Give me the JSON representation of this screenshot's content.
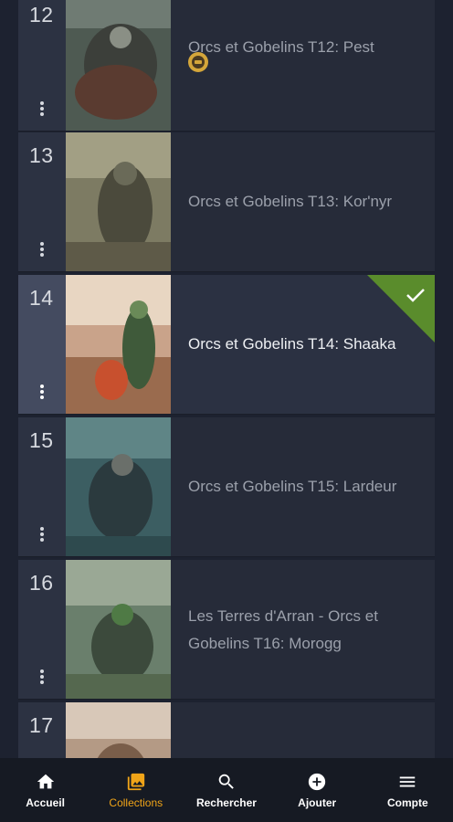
{
  "items": [
    {
      "number": "12",
      "title": "Orcs et Gobelins T12: Pest",
      "state": "reading"
    },
    {
      "number": "13",
      "title": "Orcs et Gobelins T13: Kor'nyr",
      "state": "none"
    },
    {
      "number": "14",
      "title": "Orcs et Gobelins T14: Shaaka",
      "state": "owned"
    },
    {
      "number": "15",
      "title": "Orcs et Gobelins T15: Lardeur",
      "state": "none"
    },
    {
      "number": "16",
      "title": "Les Terres d'Arran - Orcs et Gobelins T16: Morogg",
      "state": "none"
    },
    {
      "number": "17",
      "title": "",
      "state": "none"
    }
  ],
  "nav": {
    "home": "Accueil",
    "collections": "Collections",
    "search": "Rechercher",
    "add": "Ajouter",
    "account": "Compte"
  },
  "colors": {
    "accent": "#f0a418",
    "owned": "#5a8c2c",
    "background": "#1d2230"
  }
}
